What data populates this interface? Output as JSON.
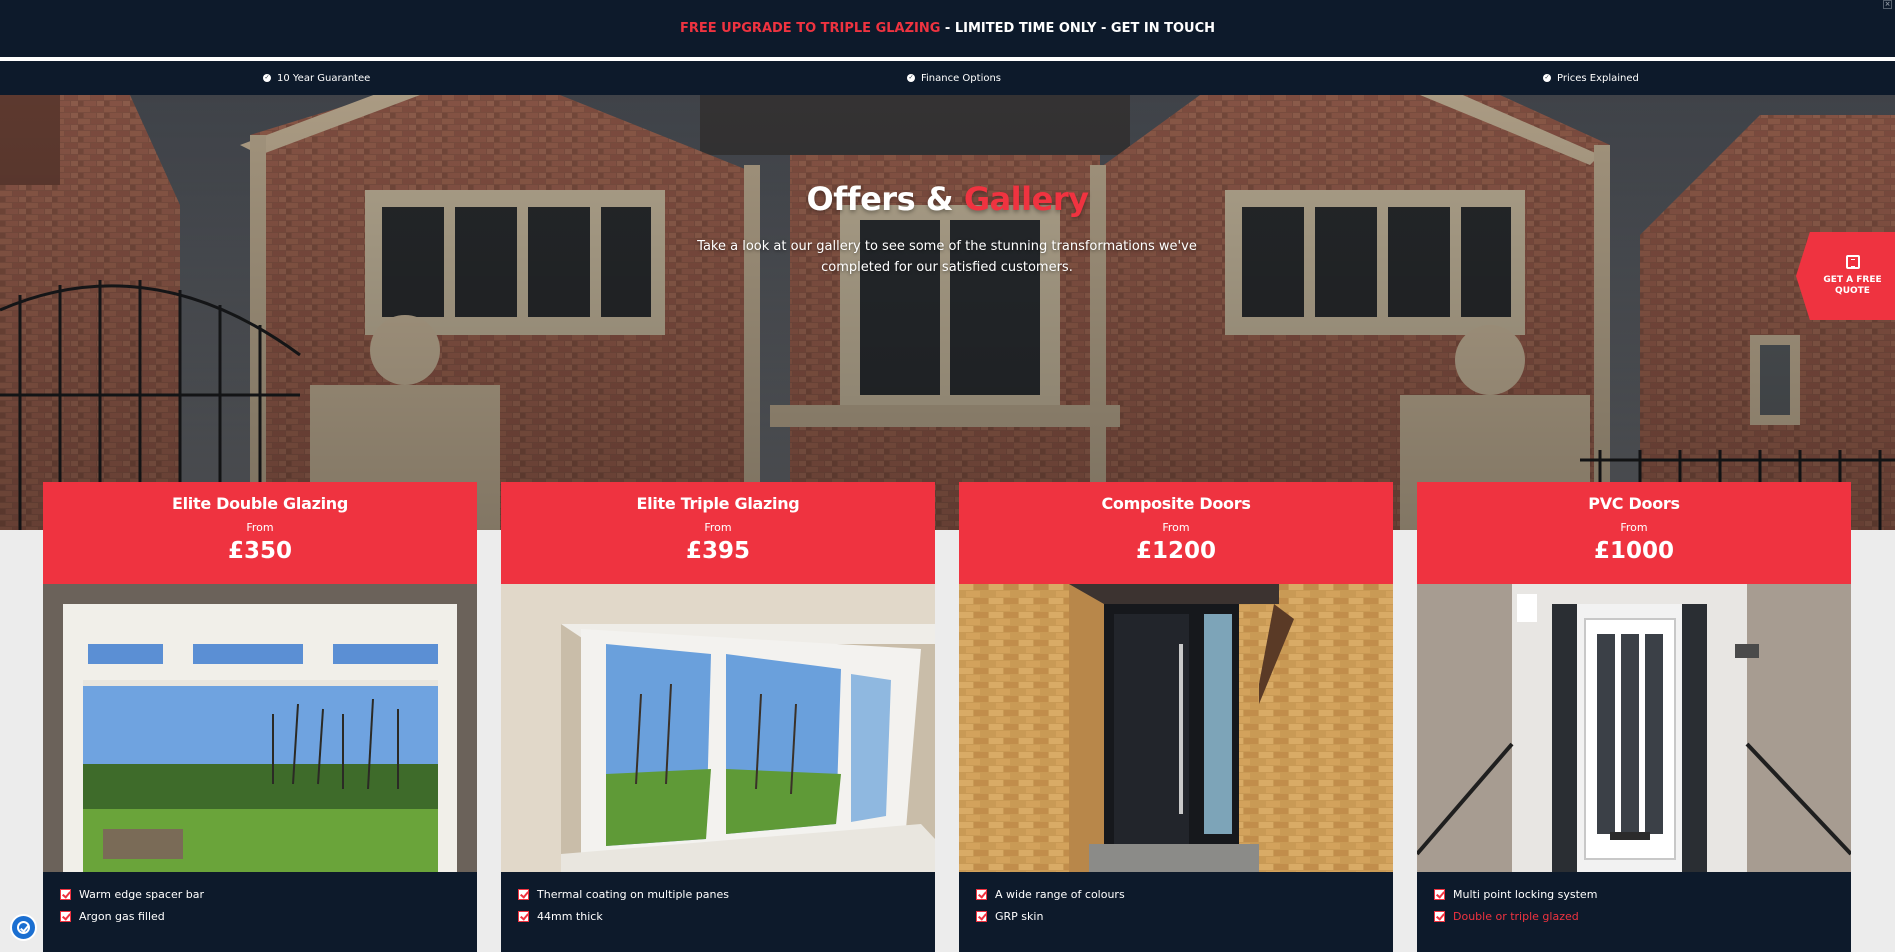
{
  "banner": {
    "highlight": "FREE UPGRADE TO TRIPLE GLAZING",
    "rest": " - LIMITED TIME ONLY - GET IN TOUCH"
  },
  "usps": [
    {
      "label": "10 Year Guarantee",
      "icon": "check-circle-icon"
    },
    {
      "label": "Finance Options",
      "icon": "check-circle-icon"
    },
    {
      "label": "Prices Explained",
      "icon": "check-circle-icon"
    }
  ],
  "hero": {
    "title_part1": "Offers & ",
    "title_accent": "Gallery",
    "subtitle": "Take a look at our gallery to see some of the stunning transformations we've completed for our satisfied customers."
  },
  "quote_tab": {
    "label": "GET A FREE QUOTE",
    "icon": "document-icon"
  },
  "cards": [
    {
      "name": "Elite Double Glazing",
      "from": "From",
      "price": "£350",
      "features": [
        "Warm edge spacer bar",
        "Argon gas filled"
      ]
    },
    {
      "name": "Elite Triple Glazing",
      "from": "From",
      "price": "£395",
      "features": [
        "Thermal coating on multiple panes",
        "44mm thick"
      ]
    },
    {
      "name": "Composite Doors",
      "from": "From",
      "price": "£1200",
      "features": [
        "A wide range of colours",
        "GRP skin"
      ]
    },
    {
      "name": "PVC Doors",
      "from": "From",
      "price": "£1000",
      "features": [
        "Multi point locking system",
        "Double or triple glazed"
      ]
    }
  ],
  "colors": {
    "navy": "#0d1a2b",
    "accent_red": "#ef3340",
    "white": "#ffffff",
    "page_bg": "#ececec"
  }
}
